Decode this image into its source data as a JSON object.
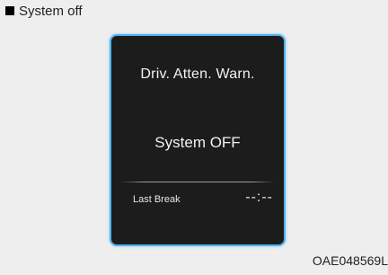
{
  "heading": {
    "icon": "square-bullet-icon",
    "text": "System off"
  },
  "display": {
    "title": "Driv. Atten. Warn.",
    "status": "System OFF",
    "last_break_label": "Last Break",
    "last_break_value": "--:--",
    "accent_color": "#4fb3ee",
    "background_color": "#1c1c1c"
  },
  "figure_code": "OAE048569L"
}
